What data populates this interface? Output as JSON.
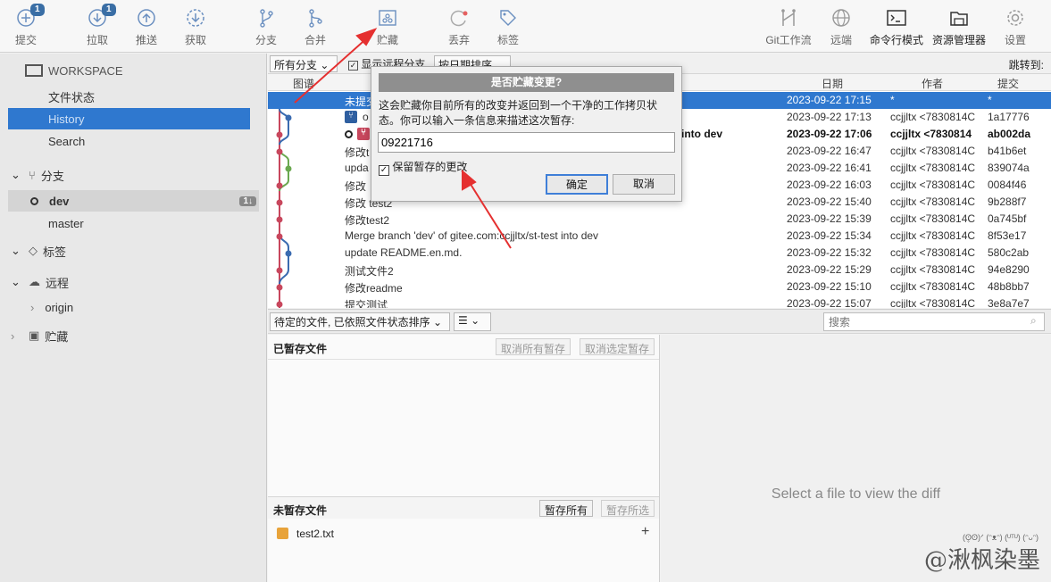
{
  "toolbar": {
    "commit": "提交",
    "commit_badge": "1",
    "pull": "拉取",
    "pull_badge": "1",
    "push": "推送",
    "fetch": "获取",
    "branch": "分支",
    "merge": "合并",
    "stash": "贮藏",
    "discard": "丢弃",
    "tag": "标签",
    "gitflow": "Git工作流",
    "remote": "远端",
    "terminal": "命令行模式",
    "explorer": "资源管理器",
    "settings": "设置"
  },
  "sidebar": {
    "workspace": "WORKSPACE",
    "file_status": "文件状态",
    "history": "History",
    "search": "Search",
    "branches": "分支",
    "dev": "dev",
    "dev_badge": "1↓",
    "master": "master",
    "tags": "标签",
    "remotes": "远程",
    "origin": "origin",
    "stashes": "贮藏"
  },
  "filter": {
    "all_branches": "所有分支",
    "show_remote": "显示远程分支",
    "sort": "按日期排序",
    "jump": "跳转到:"
  },
  "columns": {
    "graph": "图谱",
    "date": "日期",
    "author": "作者",
    "commit": "提交"
  },
  "commits": [
    {
      "msg": "未提交",
      "date": "2023-09-22 17:15",
      "author": "*",
      "hash": "*"
    },
    {
      "msg": "o",
      "date": "2023-09-22 17:13",
      "author": "ccjjltx <7830814C",
      "hash": "1a17776"
    },
    {
      "msg": "into dev",
      "date": "2023-09-22 17:06",
      "author": "ccjjltx <7830814",
      "hash": "ab002da"
    },
    {
      "msg": "修改t",
      "date": "2023-09-22 16:47",
      "author": "ccjjltx <7830814C",
      "hash": "b41b6et"
    },
    {
      "msg": "upda",
      "date": "2023-09-22 16:41",
      "author": "ccjjltx <7830814C",
      "hash": "839074a"
    },
    {
      "msg": "修改",
      "date": "2023-09-22 16:03",
      "author": "ccjjltx <7830814C",
      "hash": "0084f46"
    },
    {
      "msg": "修改 test2",
      "date": "2023-09-22 15:40",
      "author": "ccjjltx <7830814C",
      "hash": "9b288f7"
    },
    {
      "msg": "修改test2",
      "date": "2023-09-22 15:39",
      "author": "ccjjltx <7830814C",
      "hash": "0a745bf"
    },
    {
      "msg": "Merge branch 'dev' of gitee.com:ccjjltx/st-test into dev",
      "date": "2023-09-22 15:34",
      "author": "ccjjltx <7830814C",
      "hash": "8f53e17"
    },
    {
      "msg": "update README.en.md.",
      "date": "2023-09-22 15:32",
      "author": "ccjjltx <7830814C",
      "hash": "580c2ab"
    },
    {
      "msg": "测试文件2",
      "date": "2023-09-22 15:29",
      "author": "ccjjltx <7830814C",
      "hash": "94e8290"
    },
    {
      "msg": "修改readme",
      "date": "2023-09-22 15:10",
      "author": "ccjjltx <7830814C",
      "hash": "48b8bb7"
    },
    {
      "msg": "提交测试",
      "date": "2023-09-22 15:07",
      "author": "ccjjltx <7830814C",
      "hash": "3e8a7e7"
    }
  ],
  "files_bar": {
    "pending_sort": "待定的文件, 已依照文件状态排序",
    "search_placeholder": "搜索"
  },
  "staged": {
    "title": "已暂存文件",
    "unstage_all": "取消所有暂存",
    "unstage_selected": "取消选定暂存"
  },
  "unstaged": {
    "title": "未暂存文件",
    "stage_all": "暂存所有",
    "stage_selected": "暂存所选",
    "file": "test2.txt"
  },
  "diff_placeholder": "Select a file to view the diff",
  "dialog": {
    "title": "是否贮藏变更?",
    "desc1": "这会贮藏你目前所有的改变并返回到一个干净的工作拷贝状",
    "desc2": "态。你可以输入一条信息来描述这次暂存:",
    "input": "09221716",
    "keep_label": "保留暂存的更改",
    "ok": "确定",
    "cancel": "取消"
  },
  "watermark": "@湫枫染墨",
  "watermark_faces": "(ʘ̥ʘ)ᐟ (ᵔᴥᵔ) (ᵁᵀᵁ) (ᵔᴗᵔ)"
}
